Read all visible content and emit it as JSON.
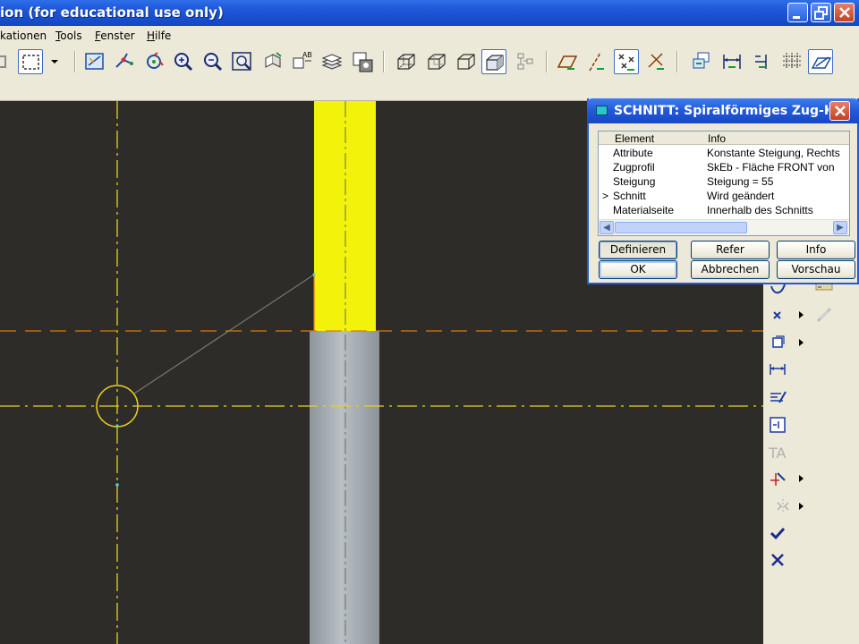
{
  "window": {
    "title": "ion (for educational use only)"
  },
  "menu": {
    "items": [
      {
        "label": "kationen",
        "u": ""
      },
      {
        "label": "ools",
        "u": "T"
      },
      {
        "label": "enster",
        "u": "F"
      },
      {
        "label": "ilfe",
        "u": "H"
      }
    ]
  },
  "toolbar": {
    "icons": [
      "select-box-icon",
      "dropdown-arrow-icon",
      "view-repaint-icon",
      "datum-axis-icon",
      "spin-center-icon",
      "zoom-in-icon",
      "zoom-out-icon",
      "refit-icon",
      "orient-icon",
      "named-views-icon",
      "layers-icon",
      "model-tree-icon",
      "wireframe-icon",
      "hidden-line-icon",
      "no-hidden-icon",
      "shaded-icon",
      "datum-display-icon",
      "datum-planes-icon",
      "datum-axes-icon",
      "datum-points-icon",
      "datum-csys-icon",
      "sketch-refs-icon",
      "dimension-icon",
      "constraints-icon",
      "grid-icon",
      "sketch-orient-icon"
    ]
  },
  "dialog": {
    "title": "SCHNITT: Spiralförmiges Zug-KE",
    "columns": {
      "element": "Element",
      "info": "Info"
    },
    "rows": [
      {
        "marker": "",
        "element": "Attribute",
        "info": "Konstante Steigung, Rechts"
      },
      {
        "marker": "",
        "element": "Zugprofil",
        "info": "SkEb - Fläche FRONT   von"
      },
      {
        "marker": "",
        "element": "Steigung",
        "info": "Steigung = 55"
      },
      {
        "marker": ">",
        "element": "Schnitt",
        "info": "Wird geändert"
      },
      {
        "marker": "",
        "element": "Materialseite",
        "info": "Innerhalb des Schnitts"
      }
    ],
    "buttons": {
      "define": "Definieren",
      "refer": "Refer",
      "info": "Info",
      "ok": "OK",
      "cancel": "Abbrechen",
      "preview": "Vorschau"
    }
  },
  "colors": {
    "background": "#2e2c29",
    "cylinder_top": "#f2f20a",
    "cylinder_bottom": "#b4bbc2",
    "centerline": "#e8d21a",
    "dash_orange": "#d87a10",
    "accent_blue": "#1d56d8"
  },
  "side_toolbar": {
    "icons": [
      "spline-icon",
      "point-icon",
      "coordinate-system-icon",
      "dimension-icon",
      "modify-icon",
      "constraint-icon",
      "text-icon",
      "trim-icon",
      "mirror-icon",
      "accept-icon",
      "cancel-icon",
      "palette-icon",
      "chain-icon"
    ]
  }
}
